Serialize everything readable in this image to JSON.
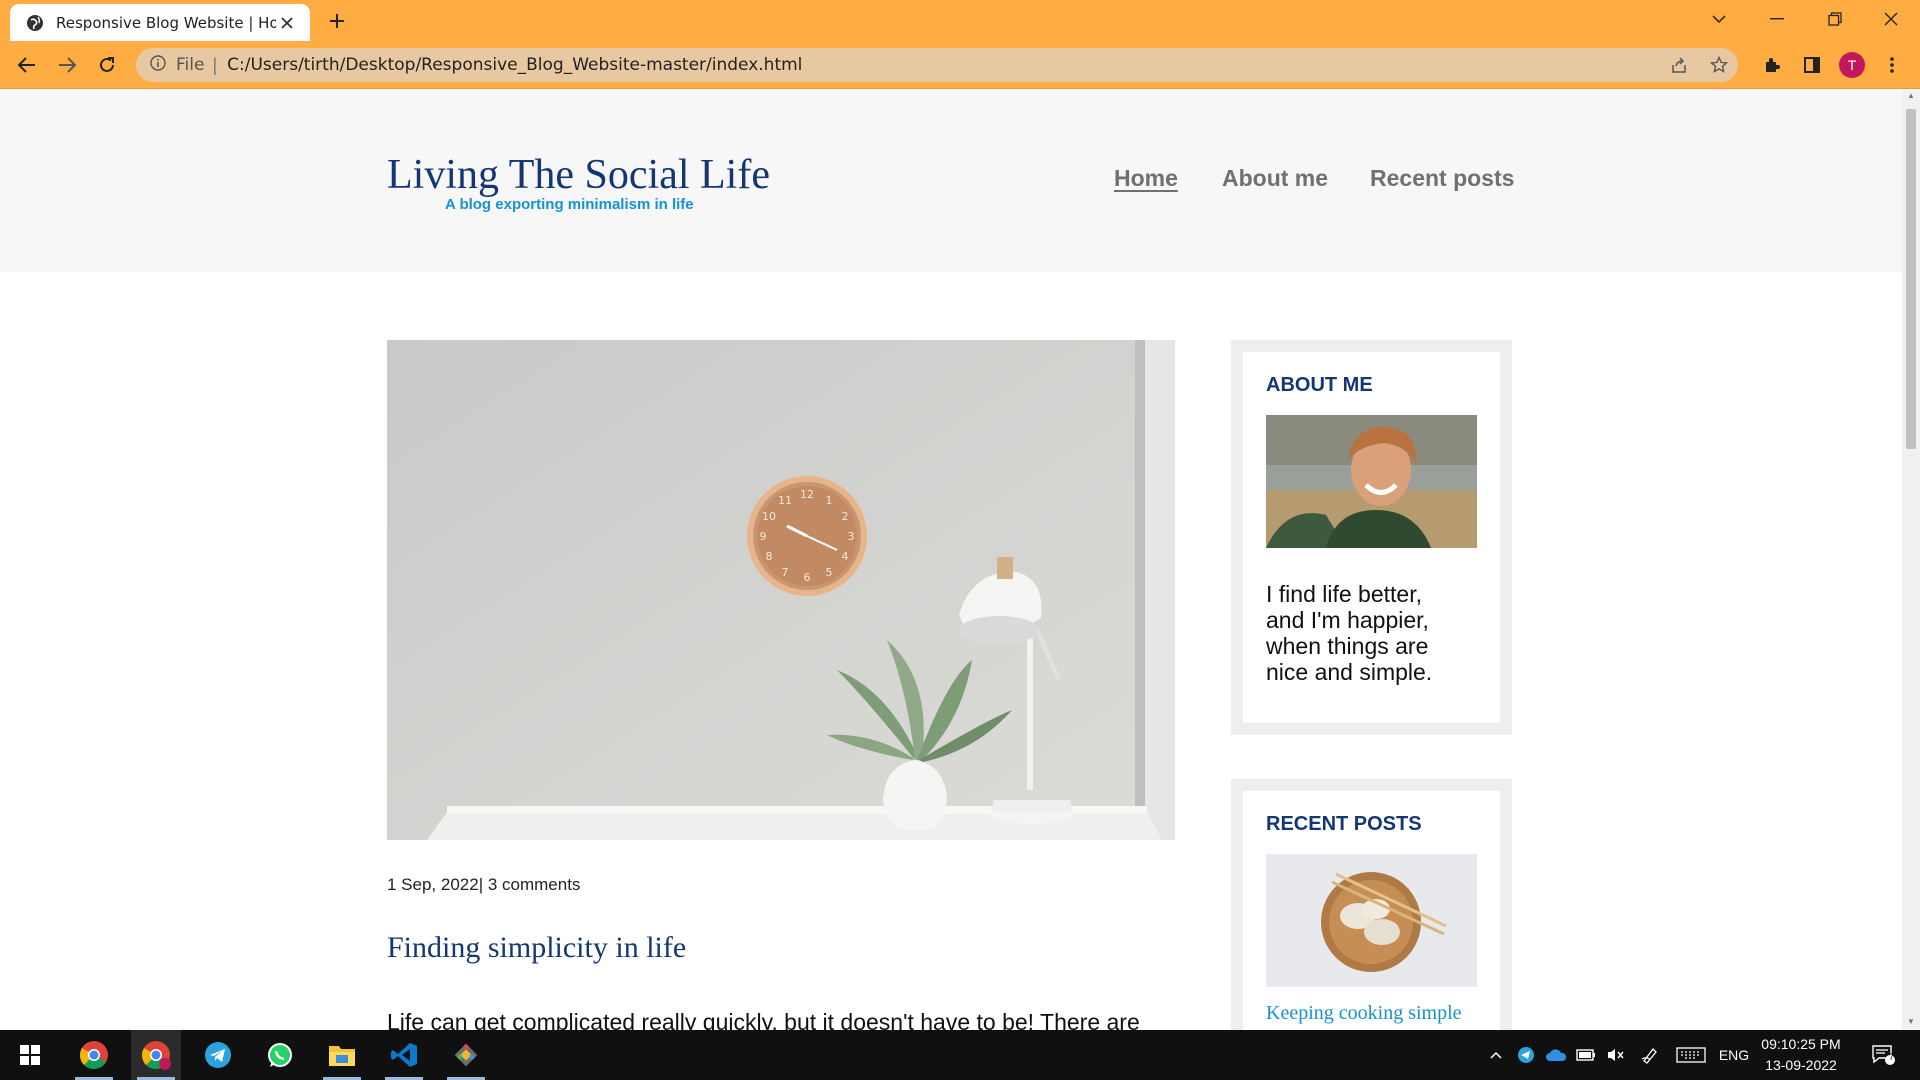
{
  "browser": {
    "tab_title": "Responsive Blog Website | Home",
    "file_label": "File",
    "url": "C:/Users/tirth/Desktop/Responsive_Blog_Website-master/index.html",
    "profile_initial": "T",
    "accent_color": "#FFAC42"
  },
  "site": {
    "title": "Living The Social Life",
    "subtitle": "A blog exporting minimalism in life",
    "nav": [
      {
        "label": "Home",
        "active": true
      },
      {
        "label": "About me",
        "active": false
      },
      {
        "label": "Recent posts",
        "active": false
      }
    ]
  },
  "post": {
    "meta": "1 Sep, 2022| 3 comments",
    "title": "Finding simplicity in life",
    "excerpt": "Life can get complicated really quickly, but it doesn't have to be! There are"
  },
  "sidebar": {
    "about": {
      "heading": "ABOUT ME",
      "text": "I find life better, and I'm happier, when things are nice and simple."
    },
    "recent": {
      "heading": "RECENT POSTS",
      "first_link": "Keeping cooking simple"
    }
  },
  "taskbar": {
    "apps": [
      "windows-start-icon",
      "chrome-icon",
      "chrome-profile-icon",
      "telegram-icon",
      "whatsapp-icon",
      "file-explorer-icon",
      "vscode-icon",
      "git-icon"
    ],
    "language": "ENG",
    "time": "09:10:25 PM",
    "date": "13-09-2022",
    "notification_count": "7"
  },
  "colors": {
    "site_title": "#143774",
    "link": "#1792d2",
    "header_bg": "#F7F7F7"
  }
}
